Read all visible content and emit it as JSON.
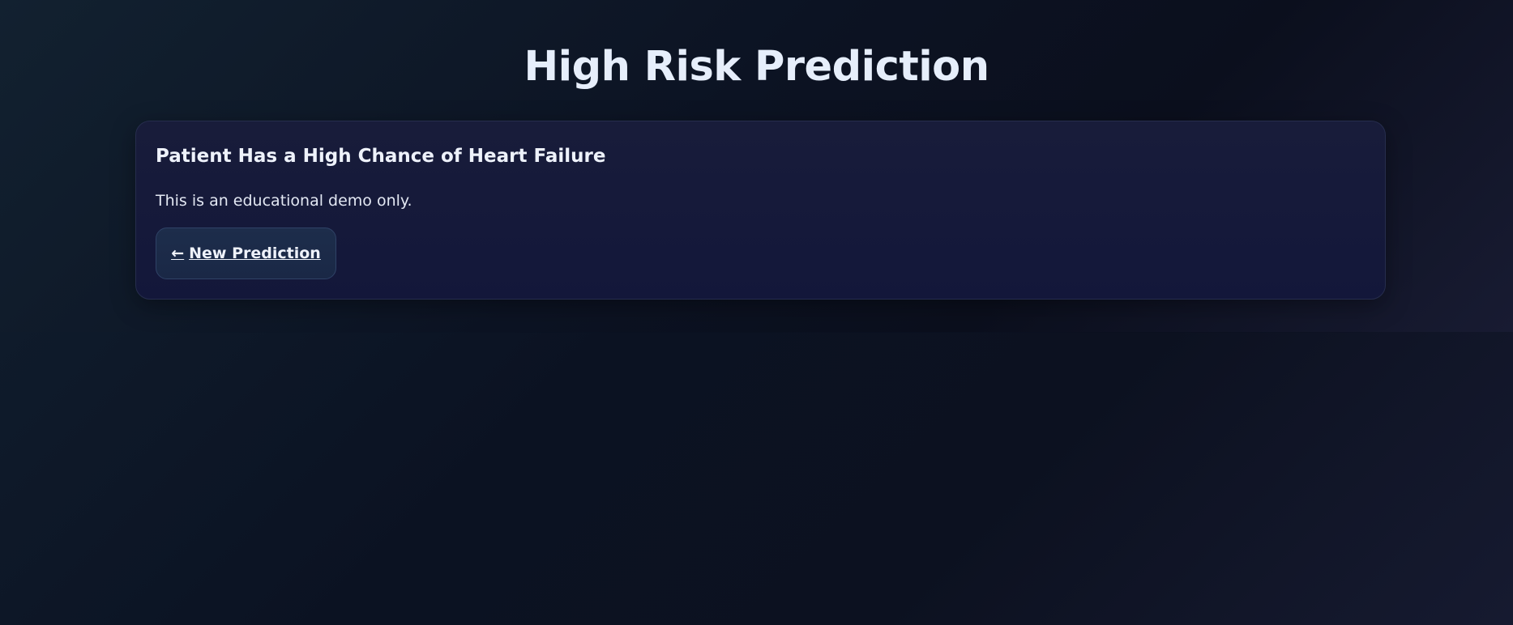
{
  "page": {
    "title": "High Risk Prediction"
  },
  "result_card": {
    "heading": "Patient Has a High Chance of Heart Failure",
    "note": "This is an educational demo only.",
    "button": {
      "icon": "←",
      "icon_name": "left-arrow-icon",
      "label": "New Prediction"
    }
  },
  "colors": {
    "background": "#0b1222",
    "card": "#161a3a",
    "button": "#1c2b49",
    "text": "#e6eefb"
  }
}
